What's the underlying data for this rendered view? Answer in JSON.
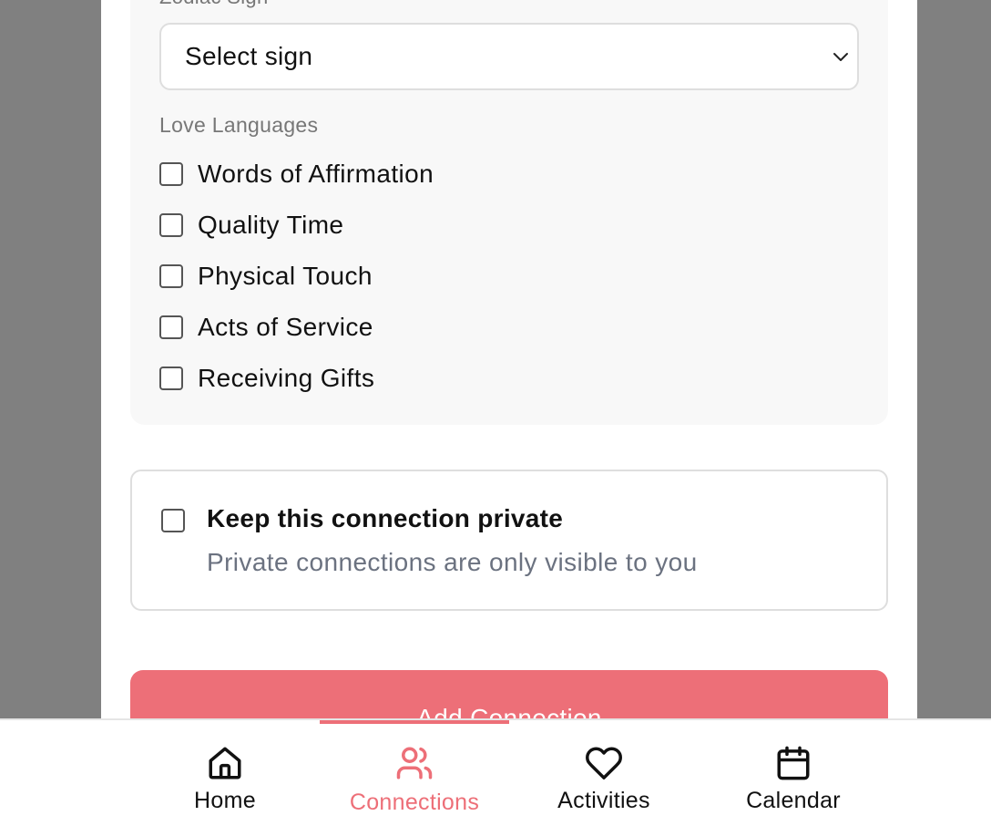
{
  "form": {
    "zodiac_label": "Zodiac Sign",
    "zodiac_select": "Select sign",
    "love_languages_label": "Love Languages",
    "love_languages": [
      {
        "label": "Words of Affirmation",
        "checked": false
      },
      {
        "label": "Quality Time",
        "checked": false
      },
      {
        "label": "Physical Touch",
        "checked": false
      },
      {
        "label": "Acts of Service",
        "checked": false
      },
      {
        "label": "Receiving Gifts",
        "checked": false
      }
    ],
    "private_title": "Keep this connection private",
    "private_desc": "Private connections are only visible to you",
    "private_checked": false,
    "submit_label": "Add Connection"
  },
  "nav": {
    "active": "Connections",
    "items": [
      {
        "label": "Home",
        "icon": "home-icon"
      },
      {
        "label": "Connections",
        "icon": "users-icon"
      },
      {
        "label": "Activities",
        "icon": "heart-icon"
      },
      {
        "label": "Calendar",
        "icon": "calendar-icon"
      }
    ]
  },
  "colors": {
    "accent": "#ed6f78",
    "backdrop": "#808080",
    "muted_text": "#6b7280"
  }
}
